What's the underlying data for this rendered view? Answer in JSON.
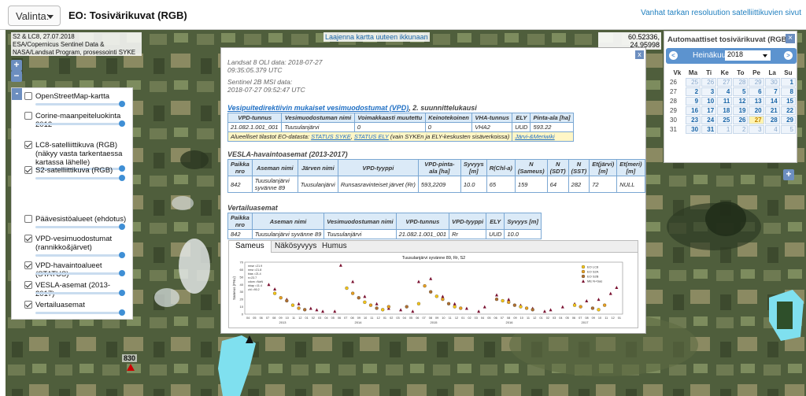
{
  "header": {
    "select_label": "Valinta:",
    "title": "EO: Tosivärikuvat (RGB)",
    "link": "Vanhat tarkan resoluution satelliittikuvien sivut"
  },
  "map": {
    "attribution": [
      "S2 & LC8, 27.07.2018",
      "ESA/Copernicus Sentinel Data &",
      "NASA/Landsat Program, prosessointi SYKE"
    ],
    "enlarge_link": "Laajenna kartta uuteen ikkunaan",
    "coords": "60.52336, 24.95998",
    "zoom_in": "+",
    "zoom_out": "−",
    "marker_label": "830"
  },
  "layers": {
    "toggle": "-",
    "items": [
      {
        "label": "OpenStreetMap-kartta",
        "checked": false
      },
      {
        "label": "Corine-maanpeiteluokinta 2012",
        "checked": false
      },
      {
        "label": "LC8-satelliittikuva (RGB) (näkyy vasta tarkentaessa kartassa lähelle)",
        "checked": true
      },
      {
        "label": "S2-satelliittikuva (RGB)",
        "checked": true
      },
      {
        "label": "Päävesistöalueet (ehdotus)",
        "checked": false
      },
      {
        "label": "VPD-vesimuodostumat (rannikko&järvet)",
        "checked": true
      },
      {
        "label": "VPD-havaintoalueet (STATUS)",
        "checked": true
      },
      {
        "label": "VESLA-asemat (2013-2017)",
        "checked": true
      },
      {
        "label": "Vertailuasemat",
        "checked": true
      }
    ]
  },
  "popup": {
    "close": "x",
    "landsat": [
      "Landsat 8 OLI data: 2018-07-27",
      "09:35:05.379 UTC"
    ],
    "sentinel": [
      "Sentinel 2B MSI data:",
      "2018-07-27 09:52:47 UTC"
    ],
    "vpd": {
      "heading_link": "Vesipuitedirektiivin mukaiset vesimuodostumat (VPD)",
      "heading_rest": ", 2. suunnittelukausi",
      "headers": [
        "VPD-tunnus",
        "Vesimuodostuman nimi",
        "Voimakkaasti muutettu",
        "Keinotekoinen",
        "VHA-tunnus",
        "ELY",
        "Pinta-ala [ha]"
      ],
      "row": [
        "21.082.1.001_001",
        "Tuusulanjärvi",
        "0",
        "0",
        "VHA2",
        "UUD",
        "593.22"
      ],
      "note_prefix": "Alueelliset tilastot EO-datasta: ",
      "note_link1": "STATUS SYKE",
      "note_sep": ", ",
      "note_link2": "STATUS ELY",
      "note_rest": " (vain SYKEn ja ELY-keskusten sisäverkoissa)",
      "note_link3": "Järvi-&Meriwiki"
    },
    "vesla": {
      "heading": "VESLA-havaintoasemat (2013-2017)",
      "headers": [
        "Paikka nro",
        "Aseman nimi",
        "Järven nimi",
        "VPD-tyyppi",
        "VPD-pinta-ala [ha]",
        "Syvyys [m]",
        "R(Chl-a)",
        "N (Sameus)",
        "N (SDT)",
        "N (SST)",
        "Et(järvi) [m]",
        "Et(meri) [m]"
      ],
      "row": [
        "842",
        "Tuusulanjärvi syvänne 89",
        "Tuusulanjärvi",
        "Runsasravinteiset järvet (Rr)",
        "593,2209",
        "10.0",
        "65",
        "159",
        "64",
        "282",
        "72",
        "NULL"
      ]
    },
    "vertailu": {
      "heading": "Vertailuasemat",
      "headers": [
        "Paikka nro",
        "Aseman nimi",
        "Vesimuodostuman nimi",
        "VPD-tunnus",
        "VPD-tyyppi",
        "ELY",
        "Syvyys [m]"
      ],
      "row": [
        "842",
        "Tuusulanjärvi syvänne 89",
        "Tuusulanjärvi",
        "21.082.1.001_001",
        "Rr",
        "UUD",
        "10.0"
      ]
    },
    "tabs": [
      "Sameus",
      "Näkösyvyys",
      "Humus"
    ]
  },
  "chart_data": {
    "type": "scatter",
    "title": "Tuusulanjärvi syvänne 89, Rr, S2",
    "ylabel": "Sameus (FNU)",
    "stats": [
      "rmse =21.9",
      "rmsr =21.8",
      "bias =21.4",
      "n=23.7",
      "cdom =NaN",
      "rbiap =11.4",
      "chl =90.2"
    ],
    "legend": [
      "EO LC8",
      "EO S2A",
      "EO S2B",
      "ME N+Sas"
    ],
    "colors": {
      "lc8": "#f5c518",
      "s2a": "#e8a020",
      "s2b": "#b07030",
      "me": "#7a1030"
    },
    "x_years": [
      "2013",
      "2014",
      "2015",
      "2016",
      "2017"
    ],
    "x_month_ticks": [
      "04",
      "05",
      "06",
      "07",
      "08",
      "09",
      "10",
      "11",
      "12",
      "01",
      "02",
      "03",
      "04",
      "05",
      "06",
      "07",
      "08",
      "09",
      "10",
      "11",
      "12",
      "01",
      "02",
      "03",
      "04",
      "05",
      "06",
      "07",
      "08",
      "09",
      "10",
      "11",
      "12",
      "01",
      "02",
      "03",
      "04",
      "05",
      "06",
      "07",
      "08",
      "09",
      "10",
      "11",
      "12",
      "01",
      "02",
      "03",
      "04",
      "05",
      "06",
      "07",
      "08",
      "09",
      "10",
      "11",
      "12",
      "01"
    ],
    "y_ticks": [
      "0",
      "10",
      "20",
      "30",
      "40",
      "50",
      "60",
      "70"
    ],
    "ylim": [
      0,
      70
    ],
    "eo_points": [
      [
        10,
        28
      ],
      [
        12,
        22
      ],
      [
        14,
        18
      ],
      [
        16,
        12
      ],
      [
        18,
        8
      ],
      [
        20,
        6
      ],
      [
        34,
        35
      ],
      [
        36,
        28
      ],
      [
        38,
        22
      ],
      [
        40,
        16
      ],
      [
        42,
        12
      ],
      [
        44,
        8
      ],
      [
        46,
        6
      ],
      [
        48,
        10
      ],
      [
        54,
        10
      ],
      [
        58,
        14
      ],
      [
        60,
        38
      ],
      [
        62,
        30
      ],
      [
        64,
        24
      ],
      [
        66,
        20
      ],
      [
        68,
        14
      ],
      [
        70,
        10
      ],
      [
        72,
        8
      ],
      [
        84,
        20
      ],
      [
        86,
        18
      ],
      [
        88,
        16
      ],
      [
        90,
        12
      ],
      [
        92,
        10
      ],
      [
        94,
        8
      ],
      [
        96,
        6
      ],
      [
        110,
        12
      ],
      [
        112,
        10
      ],
      [
        116,
        8
      ],
      [
        118,
        6
      ],
      [
        120,
        12
      ]
    ],
    "me_points": [
      [
        8,
        40
      ],
      [
        10,
        34
      ],
      [
        14,
        20
      ],
      [
        18,
        14
      ],
      [
        22,
        8
      ],
      [
        24,
        6
      ],
      [
        26,
        4
      ],
      [
        30,
        4
      ],
      [
        32,
        66
      ],
      [
        36,
        44
      ],
      [
        40,
        24
      ],
      [
        44,
        14
      ],
      [
        48,
        8
      ],
      [
        52,
        6
      ],
      [
        56,
        4
      ],
      [
        58,
        44
      ],
      [
        62,
        48
      ],
      [
        66,
        24
      ],
      [
        70,
        14
      ],
      [
        74,
        8
      ],
      [
        78,
        4
      ],
      [
        80,
        10
      ],
      [
        84,
        26
      ],
      [
        88,
        20
      ],
      [
        92,
        12
      ],
      [
        96,
        8
      ],
      [
        100,
        4
      ],
      [
        102,
        6
      ],
      [
        106,
        10
      ],
      [
        110,
        14
      ],
      [
        114,
        18
      ],
      [
        118,
        20
      ],
      [
        122,
        28
      ],
      [
        124,
        36
      ]
    ]
  },
  "calendar": {
    "title": "Automaattiset tosivärikuvat (RGB)",
    "close": "×",
    "prev": "<",
    "next": ">",
    "month": "Heinäkuu",
    "year": "2018",
    "plus": "+",
    "headers": [
      "Vk",
      "Ma",
      "Ti",
      "Ke",
      "To",
      "Pe",
      "La",
      "Su"
    ],
    "weeks": [
      {
        "wk": "26",
        "days": [
          "25",
          "26",
          "27",
          "28",
          "29",
          "30",
          "1"
        ],
        "dim": [
          0,
          1,
          2,
          3,
          4,
          5
        ]
      },
      {
        "wk": "27",
        "days": [
          "2",
          "3",
          "4",
          "5",
          "6",
          "7",
          "8"
        ],
        "dim": []
      },
      {
        "wk": "28",
        "days": [
          "9",
          "10",
          "11",
          "12",
          "13",
          "14",
          "15"
        ],
        "dim": []
      },
      {
        "wk": "29",
        "days": [
          "16",
          "17",
          "18",
          "19",
          "20",
          "21",
          "22"
        ],
        "dim": []
      },
      {
        "wk": "30",
        "days": [
          "23",
          "24",
          "25",
          "26",
          "27",
          "28",
          "29"
        ],
        "dim": [],
        "sel": 4
      },
      {
        "wk": "31",
        "days": [
          "30",
          "31",
          "1",
          "2",
          "3",
          "4",
          "5"
        ],
        "dim": [
          2,
          3,
          4,
          5,
          6
        ]
      }
    ]
  }
}
